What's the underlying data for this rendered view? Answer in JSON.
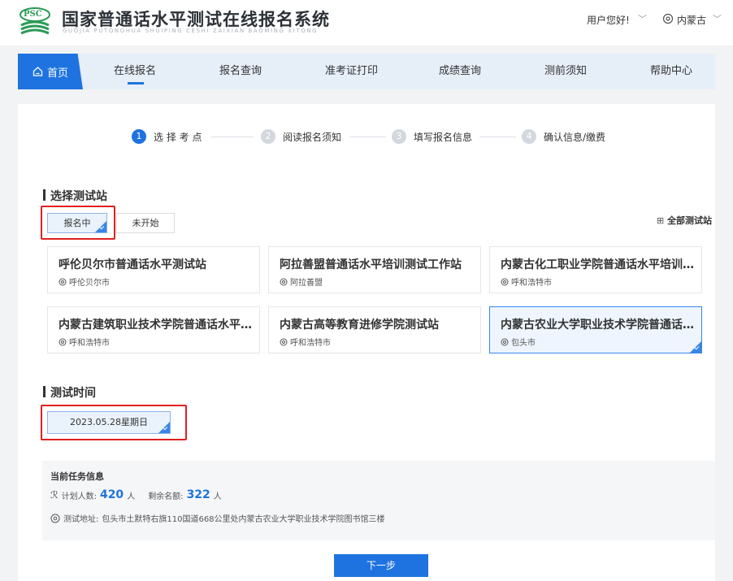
{
  "header": {
    "logo_text": "PSC",
    "title": "国家普通话水平测试在线报名系统",
    "pinyin": "GUOJIA PUTONGHUA SHUIPING CESHI ZAIXIAN BAOMING XITONG",
    "greeting": "用户您好!",
    "region": "内蒙古"
  },
  "nav": {
    "home": "首页",
    "items": [
      "在线报名",
      "报名查询",
      "准考证打印",
      "成绩查询",
      "测前须知",
      "帮助中心"
    ]
  },
  "steps": [
    {
      "num": "1",
      "label": "选 择 考 点"
    },
    {
      "num": "2",
      "label": "阅读报名须知"
    },
    {
      "num": "3",
      "label": "填写报名信息"
    },
    {
      "num": "4",
      "label": "确认信息/缴费"
    }
  ],
  "station_section": {
    "title": "选择测试站",
    "tab_active": "报名中",
    "tab_inactive": "未开始",
    "all_stations": "全部测试站"
  },
  "stations": [
    {
      "name": "呼伦贝尔市普通话水平测试站",
      "city": "呼伦贝尔市"
    },
    {
      "name": "阿拉善盟普通话水平培训测试工作站",
      "city": "阿拉善盟"
    },
    {
      "name": "内蒙古化工职业学院普通话水平培训测试站",
      "city": "呼和浩特市"
    },
    {
      "name": "内蒙古建筑职业技术学院普通话水平培训测试站",
      "city": "呼和浩特市"
    },
    {
      "name": "内蒙古高等教育进修学院测试站",
      "city": "呼和浩特市"
    },
    {
      "name": "内蒙古农业大学职业技术学院普通话水平培训测试站",
      "city": "包头市"
    }
  ],
  "time_section": {
    "title": "测试时间",
    "date": "2023.05.28星期日"
  },
  "info": {
    "title": "当前任务信息",
    "planned_label": "计划人数:",
    "planned_value": "420",
    "remaining_label": "剩余名额:",
    "remaining_value": "322",
    "unit": "人",
    "address_label": "测试地址:",
    "address": "包头市土默特右旗110国道668公里处内蒙古农业大学职业技术学院图书馆三楼"
  },
  "next_button": "下一步",
  "colors": {
    "accent": "#1e73e0",
    "highlight": "#e02020",
    "step_inactive": "#d3d7de"
  }
}
